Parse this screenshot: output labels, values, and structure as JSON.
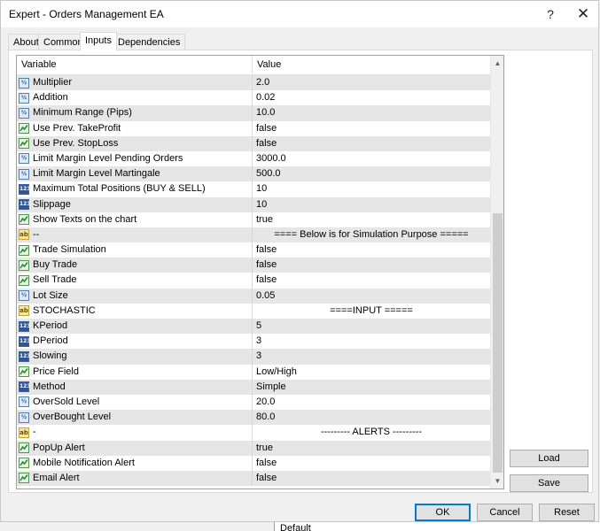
{
  "window": {
    "title": "Expert - Orders Management EA",
    "help_glyph": "?",
    "close_glyph": "✕"
  },
  "tabs": [
    {
      "label": "About",
      "active": false
    },
    {
      "label": "Common",
      "active": false
    },
    {
      "label": "Inputs",
      "active": true
    },
    {
      "label": "Dependencies",
      "active": false
    }
  ],
  "grid": {
    "columns": [
      "Variable",
      "Value"
    ],
    "rows": [
      {
        "type": "double",
        "variable": "Multiplier",
        "value": "2.0"
      },
      {
        "type": "double",
        "variable": "Addition",
        "value": "0.02"
      },
      {
        "type": "double",
        "variable": "Minimum Range (Pips)",
        "value": "10.0"
      },
      {
        "type": "bool",
        "variable": "Use Prev. TakeProfit",
        "value": "false"
      },
      {
        "type": "bool",
        "variable": "Use Prev. StopLoss",
        "value": "false"
      },
      {
        "type": "double",
        "variable": "Limit Margin Level Pending Orders",
        "value": "3000.0"
      },
      {
        "type": "double",
        "variable": "Limit Margin Level Martingale",
        "value": "500.0"
      },
      {
        "type": "int",
        "variable": "Maximum Total Positions (BUY & SELL)",
        "value": "10"
      },
      {
        "type": "int",
        "variable": "Slippage",
        "value": "10"
      },
      {
        "type": "bool",
        "variable": "Show Texts on the chart",
        "value": "true"
      },
      {
        "type": "string",
        "variable": "--",
        "value": "==== Below is for Simulation Purpose ====="
      },
      {
        "type": "bool",
        "variable": "Trade Simulation",
        "value": "false"
      },
      {
        "type": "bool",
        "variable": "Buy Trade",
        "value": "false"
      },
      {
        "type": "bool",
        "variable": "Sell Trade",
        "value": "false"
      },
      {
        "type": "double",
        "variable": "Lot Size",
        "value": "0.05"
      },
      {
        "type": "string",
        "variable": "STOCHASTIC",
        "value": "====INPUT ====="
      },
      {
        "type": "int",
        "variable": "KPeriod",
        "value": "5"
      },
      {
        "type": "int",
        "variable": "DPeriod",
        "value": "3"
      },
      {
        "type": "int",
        "variable": "Slowing",
        "value": "3"
      },
      {
        "type": "bool",
        "variable": "Price Field",
        "value": "Low/High"
      },
      {
        "type": "int",
        "variable": "Method",
        "value": "Simple"
      },
      {
        "type": "double",
        "variable": "OverSold Level",
        "value": "20.0"
      },
      {
        "type": "double",
        "variable": "OverBought Level",
        "value": "80.0"
      },
      {
        "type": "string",
        "variable": "-",
        "value": "--------- ALERTS ---------"
      },
      {
        "type": "bool",
        "variable": "PopUp Alert",
        "value": "true"
      },
      {
        "type": "bool",
        "variable": "Mobile Notification Alert",
        "value": "false"
      },
      {
        "type": "bool",
        "variable": "Email Alert",
        "value": "false"
      }
    ],
    "type_icons": {
      "double": {
        "icon": "double-type-icon",
        "glyph": "½"
      },
      "int": {
        "icon": "integer-type-icon",
        "glyph": "123"
      },
      "bool": {
        "icon": "boolean-type-icon",
        "glyph": ""
      },
      "string": {
        "icon": "string-type-icon",
        "glyph": "ab"
      }
    }
  },
  "side_buttons": {
    "load": "Load",
    "save": "Save"
  },
  "footer_buttons": {
    "ok": "OK",
    "cancel": "Cancel",
    "reset": "Reset"
  },
  "background_window": {
    "text": "Default"
  },
  "colors": {
    "accent": "#0078d7",
    "alt_row": "#e6e6e6"
  }
}
